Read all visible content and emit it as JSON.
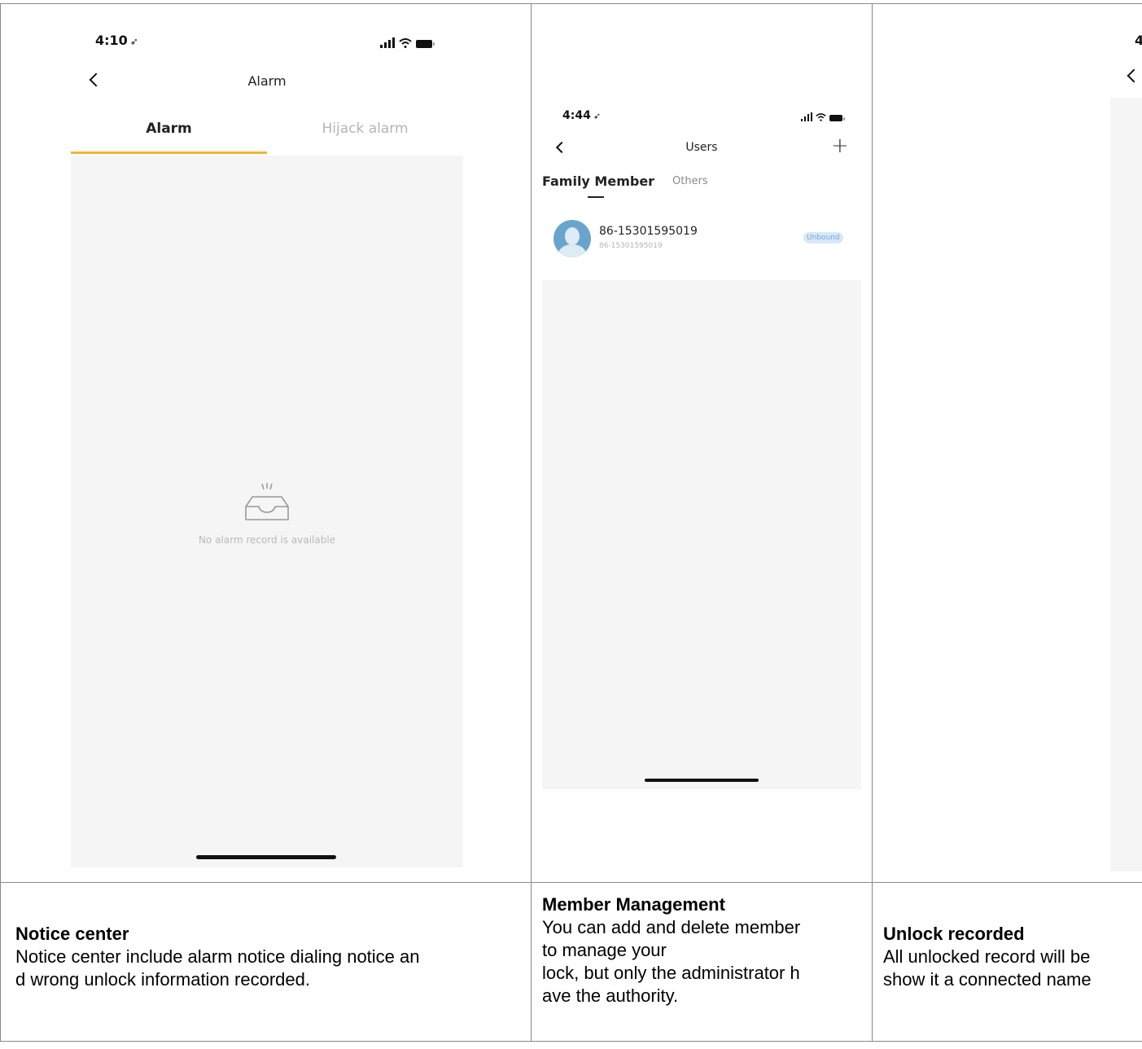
{
  "panel_alarm": {
    "status_time": "4:10",
    "title": "Alarm",
    "tabs": [
      {
        "label": "Alarm"
      },
      {
        "label": "Hijack alarm"
      }
    ],
    "empty_message": "No alarm record is available"
  },
  "panel_users": {
    "status_time": "4:44",
    "title": "Users",
    "add_symbol": "+",
    "tabs": [
      {
        "label": "Family Member"
      },
      {
        "label": "Others"
      }
    ],
    "users": [
      {
        "name": "86-15301595019",
        "account": "86-15301595019",
        "badge": "Unbound"
      }
    ]
  },
  "panel_records": {
    "status_time": "4"
  },
  "captions": [
    {
      "heading": "Notice center",
      "body": "Notice center include alarm notice dialing notice an\nd wrong unlock information recorded."
    },
    {
      "heading": "Member Management",
      "body": "You can add and delete member\nto manage your\nlock, but only the administrator h\nave the authority."
    },
    {
      "heading": "Unlock recorded",
      "body": "All unlocked record will be\nshow it a connected name"
    }
  ],
  "colors": {
    "tab_indicator": "#f5b530",
    "avatar": "#6aa4cc",
    "badge_bg": "#d8e8f8",
    "badge_text": "#7aa6d8",
    "content_bg": "#f5f5f5",
    "grid_line": "#8a8a8a"
  }
}
